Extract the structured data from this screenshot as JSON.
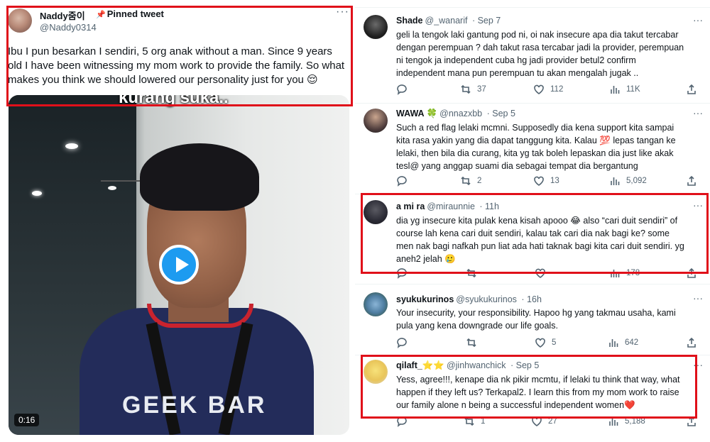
{
  "pinned": {
    "author": "Naddy줌이",
    "pinned_label": "Pinned tweet",
    "handle": "@Naddy0314",
    "text": "Ibu I pun besarkan I sendiri, 5 org anak without a man. Since 9 years old I have been witnessing my mom work to provide the family. So what makes you think we should lowered our personality just for you 😌",
    "video_caption": "kurang suka..",
    "video_brand": "GEEK BAR",
    "video_duration": "0:16"
  },
  "replies": [
    {
      "name": "Shade",
      "handle": "@_wanarif",
      "time": "· Sep 7",
      "text": "geli la tengok laki gantung pod ni, oi nak insecure apa dia takut tercabar dengan perempuan ? dah takut rasa tercabar jadi la provider, perempuan ni tengok ja independent cuba hg jadi provider betul2 confirm independent mana pun perempuan tu akan mengalah jugak ..",
      "replies": "",
      "retweets": "37",
      "likes": "112",
      "views": "11K",
      "highlighted": false
    },
    {
      "name": "WAWA 🍀",
      "handle": "@nnazxbb",
      "time": "· Sep 5",
      "text": "Such a red flag lelaki mcmni. Supposedly dia kena support kita sampai kita rasa yakin yang dia dapat tanggung kita. Kalau 💯 lepas tangan ke lelaki, then bila dia curang, kita yg tak boleh lepaskan dia just like akak tesl@ yang anggap suami dia sebagai tempat dia bergantung",
      "replies": "",
      "retweets": "2",
      "likes": "13",
      "views": "5,092",
      "highlighted": false
    },
    {
      "name": "a mi ra",
      "handle": "@miraunnie",
      "time": "· 11h",
      "text": "dia yg insecure kita pulak kena kisah apooo 😂 also “cari duit sendiri” of course lah kena cari duit sendiri, kalau tak cari dia nak bagi ke? some men nak bagi nafkah pun liat ada hati taknak bagi kita cari duit sendiri. yg aneh2 jelah 🥲",
      "replies": "",
      "retweets": "",
      "likes": "",
      "views": "178",
      "highlighted": true
    },
    {
      "name": "syukukurinos",
      "handle": "@syukukurinos",
      "time": "· 16h",
      "text": "Your insecurity, your responsibility. Hapoo hg yang takmau usaha, kami pula yang kena downgrade our life goals.",
      "replies": "",
      "retweets": "",
      "likes": "5",
      "views": "642",
      "highlighted": false
    },
    {
      "name": "qilaft_⭐⭐",
      "handle": "@jinhwanchick",
      "time": "· Sep 5",
      "text": "Yess, agree!!!, kenape dia nk pikir mcmtu, if lelaki tu think that way, what happen if they left us? Terkapal2. I learn this from my mom work to raise our family alone n being a successful independent women❤️",
      "replies": "",
      "retweets": "1",
      "likes": "27",
      "views": "5,188",
      "highlighted": true
    }
  ],
  "colors": {
    "highlight_box": "#e0101a",
    "text_primary": "#0f1419",
    "text_secondary": "#536471",
    "play_button": "#1d9bf0"
  },
  "icons": [
    "reply-icon",
    "retweet-icon",
    "like-icon",
    "views-icon",
    "share-icon",
    "more-icon",
    "pin-icon",
    "play-icon"
  ]
}
